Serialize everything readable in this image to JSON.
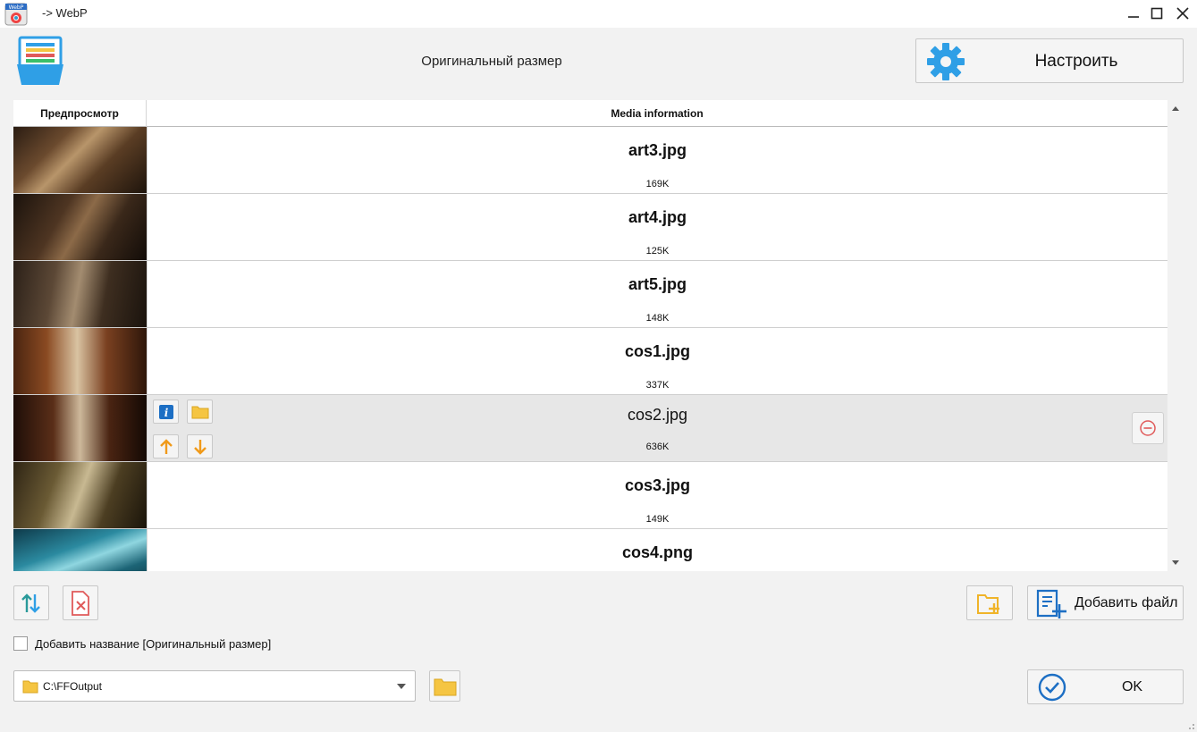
{
  "window": {
    "title": "-> WebP",
    "app_badge": "WebP"
  },
  "header": {
    "preset_label": "Оригинальный размер",
    "settings_button_label": "Настроить"
  },
  "list": {
    "columns": {
      "preview": "Предпросмотр",
      "info": "Media information"
    },
    "files": [
      {
        "name": "art3.jpg",
        "size": "169K"
      },
      {
        "name": "art4.jpg",
        "size": "125K"
      },
      {
        "name": "art5.jpg",
        "size": "148K"
      },
      {
        "name": "cos1.jpg",
        "size": "337K"
      },
      {
        "name": "cos2.jpg",
        "size": "636K"
      },
      {
        "name": "cos3.jpg",
        "size": "149K"
      },
      {
        "name": "cos4.png",
        "size": ""
      }
    ],
    "selected_index": 4
  },
  "toolbar": {
    "add_file_label": "Добавить файл"
  },
  "options": {
    "add_name_checkbox_label": "Добавить название [Оригинальный размер]",
    "add_name_checked": false
  },
  "output": {
    "path": "C:\\FFOutput"
  },
  "footer": {
    "ok_label": "OK"
  },
  "colors": {
    "accent_blue": "#2f9fe6",
    "folder_yellow": "#f5c542",
    "arrow_orange": "#f09a1a",
    "remove_red": "#e05a5a"
  }
}
